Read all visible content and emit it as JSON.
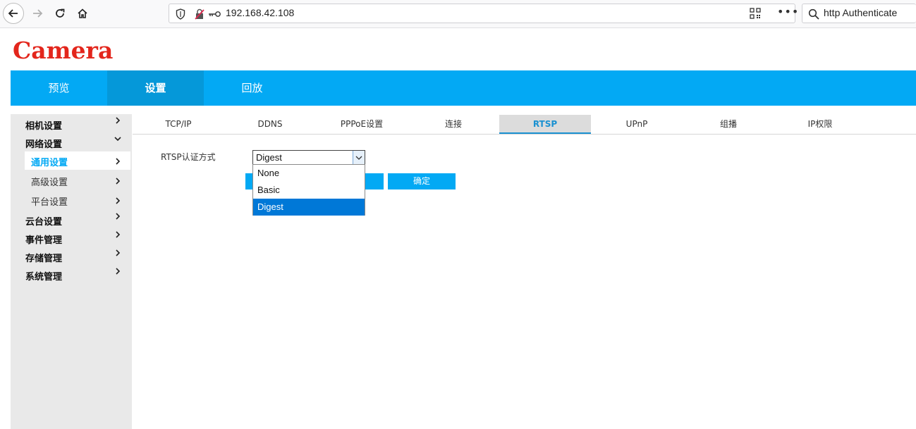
{
  "browser": {
    "url": "192.168.42.108",
    "search_text": "http  Authenticate",
    "more_label": "•••"
  },
  "logo": "Camera",
  "main_nav": [
    {
      "label": "预览"
    },
    {
      "label": "设置",
      "active": true
    },
    {
      "label": "回放"
    }
  ],
  "sidebar": {
    "groups": [
      {
        "label": "相机设置"
      },
      {
        "label": "网络设置",
        "expanded": true
      },
      {
        "label": "云台设置"
      },
      {
        "label": "事件管理"
      },
      {
        "label": "存储管理"
      },
      {
        "label": "系统管理"
      }
    ],
    "sub_items": [
      {
        "label": "通用设置",
        "active": true
      },
      {
        "label": "高级设置"
      },
      {
        "label": "平台设置"
      }
    ]
  },
  "tabs": [
    {
      "label": "TCP/IP"
    },
    {
      "label": "DDNS"
    },
    {
      "label": "PPPoE设置"
    },
    {
      "label": "连接"
    },
    {
      "label": "RTSP",
      "active": true
    },
    {
      "label": "UPnP"
    },
    {
      "label": "组播"
    },
    {
      "label": "IP权限"
    }
  ],
  "rtsp": {
    "auth_label": "RTSP认证方式",
    "auth_value": "Digest",
    "options": [
      "None",
      "Basic",
      "Digest"
    ],
    "confirm_label": "确定"
  },
  "colors": {
    "accent": "#03a9f4",
    "logo": "#e3261c",
    "selected_option": "#0078d7"
  }
}
